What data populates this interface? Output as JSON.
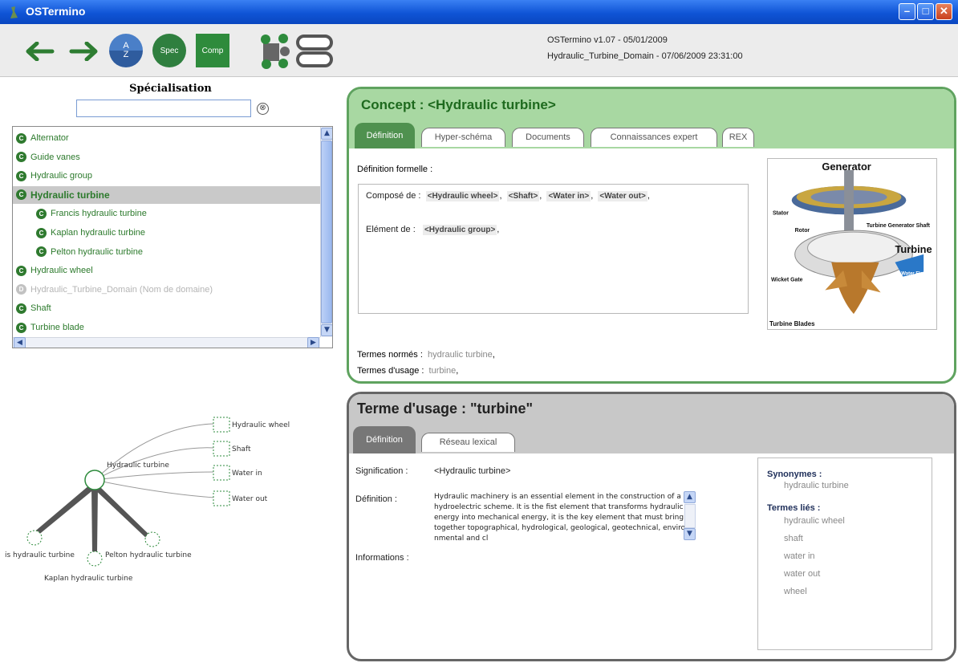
{
  "window": {
    "title": "OSTermino"
  },
  "toolbar": {
    "az_top": "A",
    "az_bottom": "Z",
    "spec_label": "Spec",
    "comp_label": "Comp",
    "version": "OSTermino v1.07 - 05/01/2009",
    "domain": "Hydraulic_Turbine_Domain - 07/06/2009 23:31:00",
    "icons": [
      "back-arrow-icon",
      "forward-arrow-icon",
      "network-icon",
      "stack-icon"
    ]
  },
  "left": {
    "title": "Spécialisation",
    "search_value": "",
    "clear_glyph": "⊗",
    "tree": [
      {
        "label": "Alternator",
        "indent": 0,
        "state": "normal"
      },
      {
        "label": "Guide vanes",
        "indent": 0,
        "state": "normal"
      },
      {
        "label": "Hydraulic group",
        "indent": 0,
        "state": "normal"
      },
      {
        "label": "Hydraulic turbine",
        "indent": 0,
        "state": "selected"
      },
      {
        "label": "Francis hydraulic turbine",
        "indent": 1,
        "state": "normal"
      },
      {
        "label": "Kaplan hydraulic turbine",
        "indent": 1,
        "state": "normal"
      },
      {
        "label": "Pelton hydraulic turbine",
        "indent": 1,
        "state": "normal"
      },
      {
        "label": "Hydraulic wheel",
        "indent": 0,
        "state": "normal"
      },
      {
        "label": "Hydraulic_Turbine_Domain (Nom de domaine)",
        "indent": 0,
        "state": "disabled"
      },
      {
        "label": "Shaft",
        "indent": 0,
        "state": "normal"
      },
      {
        "label": "Turbine blade",
        "indent": 0,
        "state": "normal"
      }
    ],
    "graph": {
      "center": "Hydraulic turbine",
      "components": [
        "Hydraulic wheel",
        "Shaft",
        "Water in",
        "Water out"
      ],
      "children": [
        "is hydraulic turbine",
        "Pelton hydraulic turbine",
        "Kaplan hydraulic turbine"
      ]
    }
  },
  "concept": {
    "title": "Concept : <Hydraulic turbine>",
    "tabs": [
      "Définition",
      "Hyper-schéma",
      "Documents",
      "Connaissances expert",
      "REX"
    ],
    "def_formelle_label": "Définition formelle :",
    "compose_label": "Composé de :",
    "compose_items": [
      "<Hydraulic wheel>",
      "<Shaft>",
      "<Water in>",
      "<Water out>"
    ],
    "element_label": "Elément de :",
    "element_items": [
      "<Hydraulic group>"
    ],
    "image_labels": {
      "generator": "Generator",
      "stator": "Stator",
      "rotor": "Rotor",
      "turbine_shaft": "Turbine Generator Shaft",
      "turbine": "Turbine",
      "wicket_gate": "Wicket Gate",
      "water_flow": "Water Flow",
      "turbine_blades": "Turbine Blades"
    },
    "termes_normes_label": "Termes normés :",
    "termes_normes_value": "hydraulic turbine",
    "termes_usage_label": "Termes d'usage :",
    "termes_usage_value": "turbine"
  },
  "terme": {
    "title": "Terme d'usage : \"turbine\"",
    "tabs": [
      "Définition",
      "Réseau lexical"
    ],
    "signification_label": "Signification :",
    "signification_value": "<Hydraulic turbine>",
    "definition_label": "Définition :",
    "definition_text": "Hydraulic machinery is an essential element in the construction of a hydroelectric scheme. It is the fist element that transforms hydraulic energy into mechanical energy, it is the key element that must bring together topographical, hydrological, geological, geotechnical, environmental and cl",
    "informations_label": "Informations :",
    "synonymes_label": "Synonymes :",
    "synonymes": [
      "hydraulic turbine"
    ],
    "termes_lies_label": "Termes liés :",
    "termes_lies": [
      "hydraulic wheel",
      "shaft",
      "water in",
      "water out",
      "wheel"
    ]
  },
  "colors": {
    "concept_green": "#a8d8a2",
    "tree_green": "#2f7a2f",
    "terme_grey": "#c8c8c8"
  }
}
